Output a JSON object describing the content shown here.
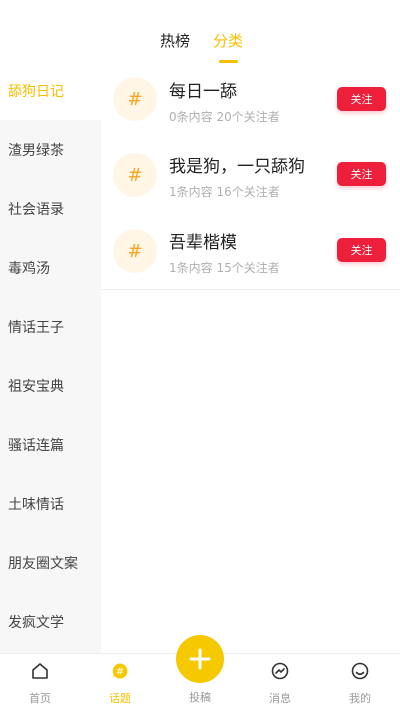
{
  "top_tabs": [
    {
      "label": "热榜",
      "active": false
    },
    {
      "label": "分类",
      "active": true
    }
  ],
  "colors": {
    "accent": "#f5c000",
    "follow_button": "#ee1f3b",
    "hash_icon": "#f5a623"
  },
  "sidebar": {
    "items": [
      {
        "label": "舔狗日记",
        "active": true
      },
      {
        "label": "渣男绿茶",
        "active": false
      },
      {
        "label": "社会语录",
        "active": false
      },
      {
        "label": "毒鸡汤",
        "active": false
      },
      {
        "label": "情话王子",
        "active": false
      },
      {
        "label": "祖安宝典",
        "active": false
      },
      {
        "label": "骚话连篇",
        "active": false
      },
      {
        "label": "土味情话",
        "active": false
      },
      {
        "label": "朋友圈文案",
        "active": false
      },
      {
        "label": "发疯文学",
        "active": false
      }
    ]
  },
  "topics": [
    {
      "icon": "#",
      "title": "每日一舔",
      "meta": "0条内容 20个关注者",
      "follow_label": "关注"
    },
    {
      "icon": "#",
      "title": "我是狗，一只舔狗",
      "meta": "1条内容 16个关注者",
      "follow_label": "关注"
    },
    {
      "icon": "#",
      "title": "吾辈楷模",
      "meta": "1条内容 15个关注者",
      "follow_label": "关注"
    }
  ],
  "bottom_nav": {
    "home": {
      "label": "首页",
      "icon": "home-icon"
    },
    "topics": {
      "label": "话题",
      "icon": "topic-icon",
      "active": true
    },
    "post": {
      "label": "投稿",
      "icon": "plus-icon"
    },
    "messages": {
      "label": "消息",
      "icon": "message-icon"
    },
    "me": {
      "label": "我的",
      "icon": "smile-icon"
    }
  }
}
